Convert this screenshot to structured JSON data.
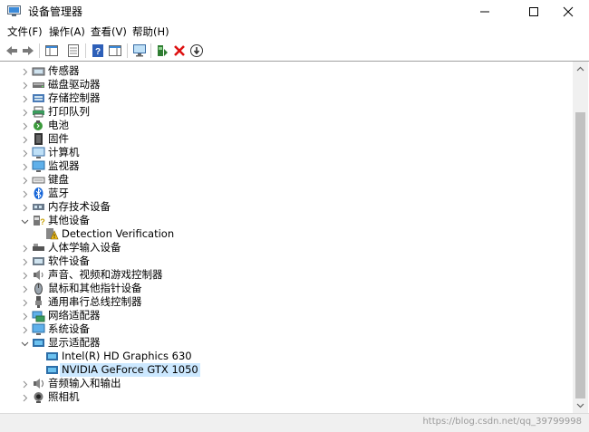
{
  "window": {
    "title": "设备管理器"
  },
  "menu": [
    {
      "label": "文件(F)"
    },
    {
      "label": "操作(A)"
    },
    {
      "label": "查看(V)"
    },
    {
      "label": "帮助(H)"
    }
  ],
  "toolbar": [
    {
      "icon": "back-arrow-icon"
    },
    {
      "icon": "forward-arrow-icon"
    },
    {
      "icon": "show-hide-console-tree-icon"
    },
    {
      "icon": "properties-icon"
    },
    {
      "icon": "help-icon"
    },
    {
      "icon": "action-pane-icon"
    },
    {
      "icon": "scan-hardware-changes-icon"
    },
    {
      "icon": "update-driver-icon"
    },
    {
      "icon": "uninstall-device-icon"
    },
    {
      "icon": "disable-device-icon"
    }
  ],
  "tree": [
    {
      "label": "传感器",
      "icon": "sensor-icon",
      "expanded": false
    },
    {
      "label": "磁盘驱动器",
      "icon": "disk-drive-icon",
      "expanded": false
    },
    {
      "label": "存储控制器",
      "icon": "storage-controller-icon",
      "expanded": false
    },
    {
      "label": "打印队列",
      "icon": "printer-icon",
      "expanded": false
    },
    {
      "label": "电池",
      "icon": "battery-icon",
      "expanded": false
    },
    {
      "label": "固件",
      "icon": "firmware-icon",
      "expanded": false
    },
    {
      "label": "计算机",
      "icon": "computer-icon",
      "expanded": false
    },
    {
      "label": "监视器",
      "icon": "monitor-icon",
      "expanded": false
    },
    {
      "label": "键盘",
      "icon": "keyboard-icon",
      "expanded": false
    },
    {
      "label": "蓝牙",
      "icon": "bluetooth-icon",
      "expanded": false
    },
    {
      "label": "内存技术设备",
      "icon": "memory-device-icon",
      "expanded": false
    },
    {
      "label": "其他设备",
      "icon": "other-devices-icon",
      "expanded": true
    },
    {
      "label": "Detection Verification",
      "icon": "unknown-device-warning-icon",
      "child": true
    },
    {
      "label": "人体学输入设备",
      "icon": "hid-icon",
      "expanded": false
    },
    {
      "label": "软件设备",
      "icon": "software-device-icon",
      "expanded": false
    },
    {
      "label": "声音、视频和游戏控制器",
      "icon": "sound-icon",
      "expanded": false
    },
    {
      "label": "鼠标和其他指针设备",
      "icon": "mouse-icon",
      "expanded": false
    },
    {
      "label": "通用串行总线控制器",
      "icon": "usb-icon",
      "expanded": false
    },
    {
      "label": "网络适配器",
      "icon": "network-adapter-icon",
      "expanded": false
    },
    {
      "label": "系统设备",
      "icon": "system-device-icon",
      "expanded": false
    },
    {
      "label": "显示适配器",
      "icon": "display-adapter-icon",
      "expanded": true
    },
    {
      "label": "Intel(R) HD Graphics 630",
      "icon": "display-adapter-icon",
      "child": true
    },
    {
      "label": "NVIDIA GeForce GTX 1050",
      "icon": "display-adapter-icon",
      "child": true,
      "selected": true
    },
    {
      "label": "音频输入和输出",
      "icon": "audio-io-icon",
      "expanded": false
    },
    {
      "label": "照相机",
      "icon": "camera-icon",
      "expanded": false
    }
  ],
  "status": {
    "watermark": "https://blog.csdn.net/qq_39799998"
  },
  "colors": {
    "selection": "#cce8ff",
    "accent": "#0078d7"
  }
}
